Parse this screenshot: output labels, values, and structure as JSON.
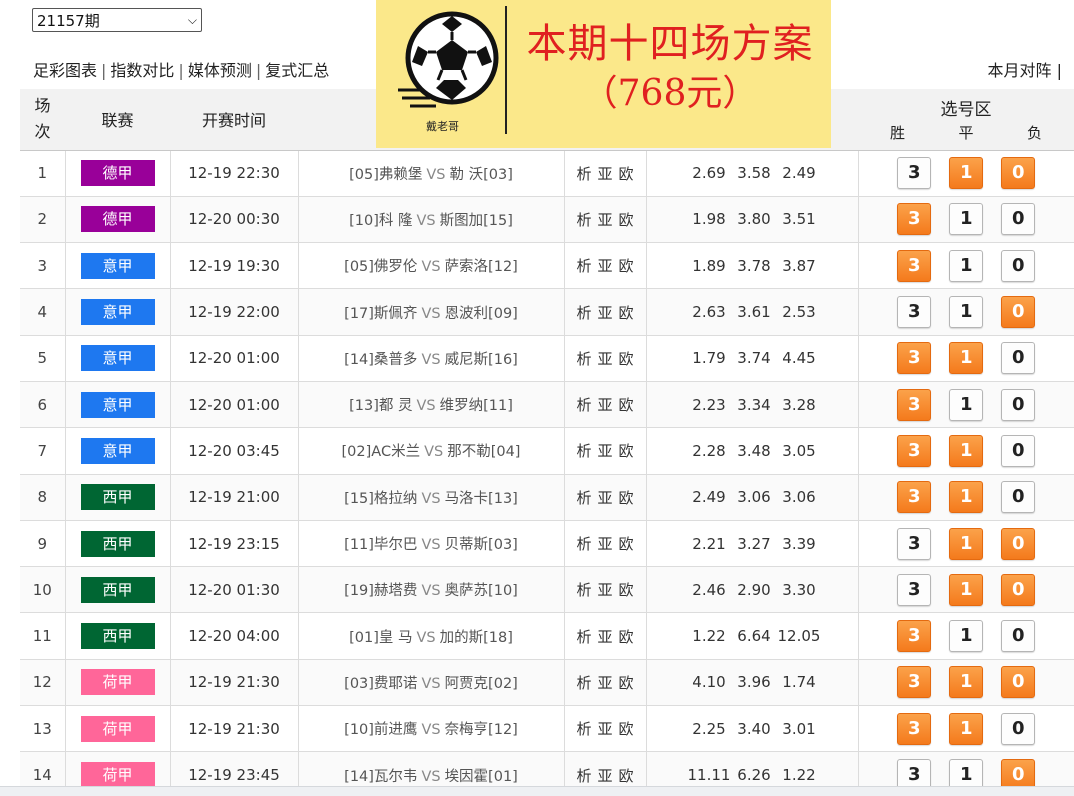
{
  "period_select": {
    "value": "21157期"
  },
  "topnav": {
    "links": [
      "足彩图表",
      "指数对比",
      "媒体预测",
      "复式汇总"
    ],
    "separator": "|",
    "right_link": "本月对阵",
    "right_sep": "|"
  },
  "banner": {
    "title": "本期十四场方案",
    "price": "（768元）",
    "logo_text": "戴老哥",
    "colors": {
      "background": "#fbe88a",
      "text": "#e02020"
    }
  },
  "table": {
    "headers": {
      "scene_line1": "场",
      "scene_line2": "次",
      "league": "联赛",
      "time": "开赛时间",
      "pick_zone": "选号区",
      "win": "胜",
      "draw": "平",
      "lose": "负"
    },
    "league_colors": {
      "德甲": "#990099",
      "意甲": "#1e78f0",
      "西甲": "#006633",
      "荷甲": "#ff6699"
    },
    "rows": [
      {
        "no": "1",
        "league": "德甲",
        "time": "12-19 22:30",
        "home": "[05]弗赖堡",
        "vs": "VS",
        "away": "勒 沃[03]",
        "a1": "析",
        "a2": "亚",
        "a3": "欧",
        "o1": "2.69",
        "o2": "3.58",
        "o3": "2.49",
        "p3": "3",
        "p1": "1",
        "p0": "0",
        "sel": [
          false,
          true,
          true
        ]
      },
      {
        "no": "2",
        "league": "德甲",
        "time": "12-20 00:30",
        "home": "[10]科 隆",
        "vs": "VS",
        "away": "斯图加[15]",
        "a1": "析",
        "a2": "亚",
        "a3": "欧",
        "o1": "1.98",
        "o2": "3.80",
        "o3": "3.51",
        "p3": "3",
        "p1": "1",
        "p0": "0",
        "sel": [
          true,
          false,
          false
        ]
      },
      {
        "no": "3",
        "league": "意甲",
        "time": "12-19 19:30",
        "home": "[05]佛罗伦",
        "vs": "VS",
        "away": "萨索洛[12]",
        "a1": "析",
        "a2": "亚",
        "a3": "欧",
        "o1": "1.89",
        "o2": "3.78",
        "o3": "3.87",
        "p3": "3",
        "p1": "1",
        "p0": "0",
        "sel": [
          true,
          false,
          false
        ]
      },
      {
        "no": "4",
        "league": "意甲",
        "time": "12-19 22:00",
        "home": "[17]斯佩齐",
        "vs": "VS",
        "away": "恩波利[09]",
        "a1": "析",
        "a2": "亚",
        "a3": "欧",
        "o1": "2.63",
        "o2": "3.61",
        "o3": "2.53",
        "p3": "3",
        "p1": "1",
        "p0": "0",
        "sel": [
          false,
          false,
          true
        ]
      },
      {
        "no": "5",
        "league": "意甲",
        "time": "12-20 01:00",
        "home": "[14]桑普多",
        "vs": "VS",
        "away": "威尼斯[16]",
        "a1": "析",
        "a2": "亚",
        "a3": "欧",
        "o1": "1.79",
        "o2": "3.74",
        "o3": "4.45",
        "p3": "3",
        "p1": "1",
        "p0": "0",
        "sel": [
          true,
          true,
          false
        ]
      },
      {
        "no": "6",
        "league": "意甲",
        "time": "12-20 01:00",
        "home": "[13]都 灵",
        "vs": "VS",
        "away": "维罗纳[11]",
        "a1": "析",
        "a2": "亚",
        "a3": "欧",
        "o1": "2.23",
        "o2": "3.34",
        "o3": "3.28",
        "p3": "3",
        "p1": "1",
        "p0": "0",
        "sel": [
          true,
          false,
          false
        ]
      },
      {
        "no": "7",
        "league": "意甲",
        "time": "12-20 03:45",
        "home": "[02]AC米兰",
        "vs": "VS",
        "away": "那不勒[04]",
        "a1": "析",
        "a2": "亚",
        "a3": "欧",
        "o1": "2.28",
        "o2": "3.48",
        "o3": "3.05",
        "p3": "3",
        "p1": "1",
        "p0": "0",
        "sel": [
          true,
          true,
          false
        ]
      },
      {
        "no": "8",
        "league": "西甲",
        "time": "12-19 21:00",
        "home": "[15]格拉纳",
        "vs": "VS",
        "away": "马洛卡[13]",
        "a1": "析",
        "a2": "亚",
        "a3": "欧",
        "o1": "2.49",
        "o2": "3.06",
        "o3": "3.06",
        "p3": "3",
        "p1": "1",
        "p0": "0",
        "sel": [
          true,
          true,
          false
        ]
      },
      {
        "no": "9",
        "league": "西甲",
        "time": "12-19 23:15",
        "home": "[11]毕尔巴",
        "vs": "VS",
        "away": "贝蒂斯[03]",
        "a1": "析",
        "a2": "亚",
        "a3": "欧",
        "o1": "2.21",
        "o2": "3.27",
        "o3": "3.39",
        "p3": "3",
        "p1": "1",
        "p0": "0",
        "sel": [
          false,
          true,
          true
        ]
      },
      {
        "no": "10",
        "league": "西甲",
        "time": "12-20 01:30",
        "home": "[19]赫塔费",
        "vs": "VS",
        "away": "奥萨苏[10]",
        "a1": "析",
        "a2": "亚",
        "a3": "欧",
        "o1": "2.46",
        "o2": "2.90",
        "o3": "3.30",
        "p3": "3",
        "p1": "1",
        "p0": "0",
        "sel": [
          false,
          true,
          true
        ]
      },
      {
        "no": "11",
        "league": "西甲",
        "time": "12-20 04:00",
        "home": "[01]皇 马",
        "vs": "VS",
        "away": "加的斯[18]",
        "a1": "析",
        "a2": "亚",
        "a3": "欧",
        "o1": "1.22",
        "o2": "6.64",
        "o3": "12.05",
        "p3": "3",
        "p1": "1",
        "p0": "0",
        "sel": [
          true,
          false,
          false
        ]
      },
      {
        "no": "12",
        "league": "荷甲",
        "time": "12-19 21:30",
        "home": "[03]费耶诺",
        "vs": "VS",
        "away": "阿贾克[02]",
        "a1": "析",
        "a2": "亚",
        "a3": "欧",
        "o1": "4.10",
        "o2": "3.96",
        "o3": "1.74",
        "p3": "3",
        "p1": "1",
        "p0": "0",
        "sel": [
          true,
          true,
          true
        ]
      },
      {
        "no": "13",
        "league": "荷甲",
        "time": "12-19 21:30",
        "home": "[10]前进鹰",
        "vs": "VS",
        "away": "奈梅亨[12]",
        "a1": "析",
        "a2": "亚",
        "a3": "欧",
        "o1": "2.25",
        "o2": "3.40",
        "o3": "3.01",
        "p3": "3",
        "p1": "1",
        "p0": "0",
        "sel": [
          true,
          true,
          false
        ]
      },
      {
        "no": "14",
        "league": "荷甲",
        "time": "12-19 23:45",
        "home": "[14]瓦尔韦",
        "vs": "VS",
        "away": "埃因霍[01]",
        "a1": "析",
        "a2": "亚",
        "a3": "欧",
        "o1": "11.11",
        "o2": "6.26",
        "o3": "1.22",
        "p3": "3",
        "p1": "1",
        "p0": "0",
        "sel": [
          false,
          false,
          true
        ]
      }
    ]
  }
}
